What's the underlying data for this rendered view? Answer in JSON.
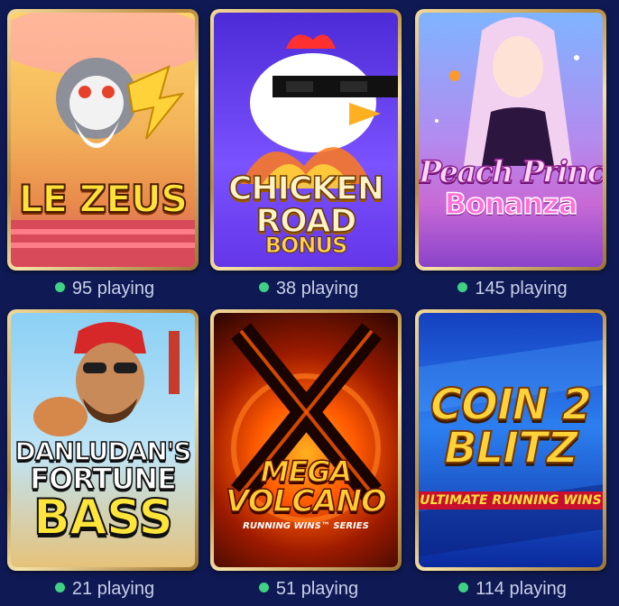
{
  "games": [
    {
      "title": "LE ZEUS",
      "playing": "95 playing",
      "icon": "zeus-character-icon",
      "colors": [
        "#f7c97a",
        "#e07a2f"
      ]
    },
    {
      "title_lines": [
        "CHICKEN",
        "ROAD",
        "BONUS"
      ],
      "playing": "38 playing",
      "icon": "chicken-sunglasses-icon",
      "colors": [
        "#5b3fe0",
        "#8f6bff"
      ]
    },
    {
      "title_lines": [
        "Peach Princess",
        "Bonanza"
      ],
      "playing": "145 playing",
      "icon": "princess-character-icon",
      "colors": [
        "#6a8cf0",
        "#c48be8"
      ]
    },
    {
      "title_lines": [
        "DANLUDAN'S",
        "FORTUNE",
        "BASS"
      ],
      "playing": "21 playing",
      "icon": "fisherman-character-icon",
      "colors": [
        "#79c6f0",
        "#e9c37b"
      ]
    },
    {
      "title_lines": [
        "MEGA",
        "VOLCANO"
      ],
      "subtitle": "RUNNING WINS™ SERIES",
      "playing": "51 playing",
      "icon": "volcano-icon",
      "colors": [
        "#2b0600",
        "#ff6a00"
      ]
    },
    {
      "title_lines": [
        "COIN 2",
        "BLITZ"
      ],
      "subtitle": "ULTIMATE RUNNING WINS",
      "playing": "114 playing",
      "icon": "coin-blitz-logo-icon",
      "colors": [
        "#0a2a9e",
        "#2c7ff0"
      ]
    }
  ]
}
